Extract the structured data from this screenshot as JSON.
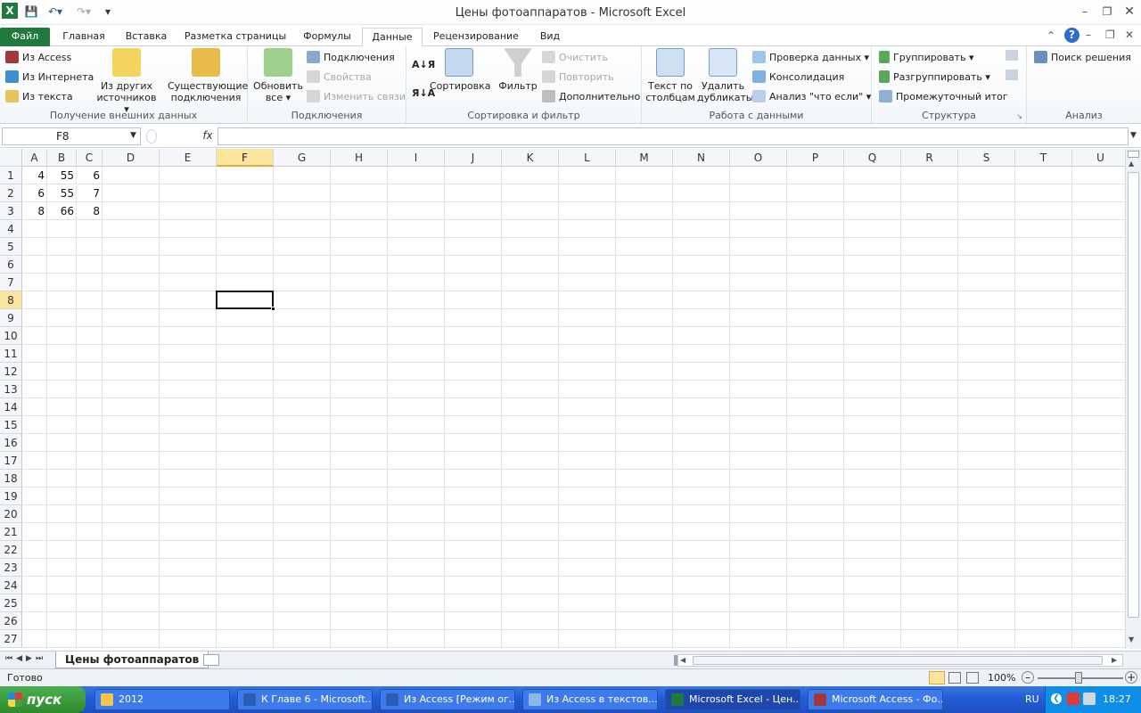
{
  "window": {
    "title": "Цены фотоаппаратов  -  Microsoft Excel"
  },
  "qat": {
    "excel_icon": "excel-icon",
    "save_icon": "save-icon",
    "undo_icon": "undo-icon",
    "redo_icon": "redo-icon",
    "customize_icon": "chevron-down-icon"
  },
  "tabs": [
    {
      "label": "Файл"
    },
    {
      "label": "Главная"
    },
    {
      "label": "Вставка"
    },
    {
      "label": "Разметка страницы"
    },
    {
      "label": "Формулы"
    },
    {
      "label": "Данные"
    },
    {
      "label": "Рецензирование"
    },
    {
      "label": "Вид"
    }
  ],
  "ribbon": {
    "ext": {
      "access": "Из Access",
      "web": "Из Интернета",
      "text": "Из текста",
      "other": "Из других источников",
      "existing": "Существующие подключения",
      "label": "Получение внешних данных"
    },
    "conn": {
      "refresh": "Обновить все",
      "connections": "Подключения",
      "properties": "Свойства",
      "editlinks": "Изменить связи",
      "label": "Подключения"
    },
    "sort": {
      "sort": "Сортировка",
      "filter": "Фильтр",
      "clear": "Очистить",
      "reapply": "Повторить",
      "advanced": "Дополнительно",
      "label": "Сортировка и фильтр"
    },
    "data": {
      "t2c": "Текст по столбцам",
      "dup": "Удалить дубликаты",
      "validation": "Проверка данных",
      "consolidate": "Консолидация",
      "whatif": "Анализ \"что если\"",
      "label": "Работа с данными"
    },
    "outline": {
      "group": "Группировать",
      "ungroup": "Разгруппировать",
      "subtotal": "Промежуточный итог",
      "label": "Структура"
    },
    "analysis": {
      "solver": "Поиск решения",
      "label": "Анализ"
    }
  },
  "formula_bar": {
    "name_box": "F8",
    "fx": "fx",
    "value": ""
  },
  "columns": [
    "A",
    "B",
    "C",
    "D",
    "E",
    "F",
    "G",
    "H",
    "I",
    "J",
    "K",
    "L",
    "M",
    "N",
    "O",
    "P",
    "Q",
    "R",
    "S",
    "T",
    "U"
  ],
  "rows": [
    "1",
    "2",
    "3",
    "4",
    "5",
    "6",
    "7",
    "8",
    "9",
    "10",
    "11",
    "12",
    "13",
    "14",
    "15",
    "16",
    "17",
    "18",
    "19",
    "20",
    "21",
    "22",
    "23",
    "24",
    "25",
    "26",
    "27"
  ],
  "cells": [
    [
      "4",
      "55",
      "6"
    ],
    [
      "6",
      "55",
      "7"
    ],
    [
      "8",
      "66",
      "8"
    ]
  ],
  "selected": {
    "col": "F",
    "row": "8"
  },
  "sheet": {
    "tab": "Цены фотоаппаратов"
  },
  "status": {
    "ready": "Готово",
    "zoom": "100%"
  },
  "taskbar": {
    "start": "пуск",
    "items": [
      {
        "label": "2012"
      },
      {
        "label": "К Главе 6 - Microsoft..."
      },
      {
        "label": "Из Access [Режим ог..."
      },
      {
        "label": "Из Access в текстов..."
      },
      {
        "label": "Microsoft Excel - Цен..."
      },
      {
        "label": "Microsoft Access - Фо..."
      }
    ],
    "lang": "RU",
    "clock": "18:27"
  }
}
